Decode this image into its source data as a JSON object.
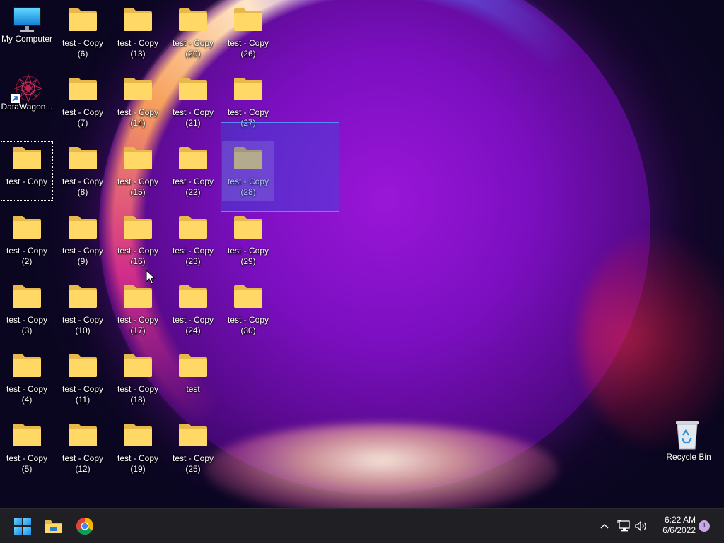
{
  "desktop": {
    "icons": [
      {
        "id": "my-computer",
        "label": "My Computer",
        "type": "monitor"
      },
      {
        "id": "datawagon",
        "label": "DataWagon...",
        "type": "shortcut"
      },
      {
        "id": "test-copy",
        "label": "test - Copy",
        "type": "folder"
      },
      {
        "id": "test-copy-2",
        "label": "test - Copy (2)",
        "type": "folder"
      },
      {
        "id": "test-copy-3",
        "label": "test - Copy (3)",
        "type": "folder"
      },
      {
        "id": "test-copy-4",
        "label": "test - Copy (4)",
        "type": "folder"
      },
      {
        "id": "test-copy-5",
        "label": "test - Copy (5)",
        "type": "folder"
      },
      {
        "id": "test-copy-6",
        "label": "test - Copy (6)",
        "type": "folder"
      },
      {
        "id": "test-copy-7",
        "label": "test - Copy (7)",
        "type": "folder"
      },
      {
        "id": "test-copy-8",
        "label": "test - Copy (8)",
        "type": "folder"
      },
      {
        "id": "test-copy-9",
        "label": "test - Copy (9)",
        "type": "folder"
      },
      {
        "id": "test-copy-10",
        "label": "test - Copy (10)",
        "type": "folder"
      },
      {
        "id": "test-copy-11",
        "label": "test - Copy (11)",
        "type": "folder"
      },
      {
        "id": "test-copy-12",
        "label": "test - Copy (12)",
        "type": "folder"
      },
      {
        "id": "test-copy-13",
        "label": "test - Copy (13)",
        "type": "folder"
      },
      {
        "id": "test-copy-14",
        "label": "test - Copy (14)",
        "type": "folder"
      },
      {
        "id": "test-copy-15",
        "label": "test - Copy (15)",
        "type": "folder"
      },
      {
        "id": "test-copy-16",
        "label": "test - Copy (16)",
        "type": "folder"
      },
      {
        "id": "test-copy-17",
        "label": "test - Copy (17)",
        "type": "folder"
      },
      {
        "id": "test-copy-18",
        "label": "test - Copy (18)",
        "type": "folder"
      },
      {
        "id": "test-copy-19",
        "label": "test - Copy (19)",
        "type": "folder"
      },
      {
        "id": "test-copy-20",
        "label": "test - Copy (20)",
        "type": "folder"
      },
      {
        "id": "test-copy-21",
        "label": "test - Copy (21)",
        "type": "folder"
      },
      {
        "id": "test-copy-22",
        "label": "test - Copy (22)",
        "type": "folder"
      },
      {
        "id": "test-copy-23",
        "label": "test - Copy (23)",
        "type": "folder"
      },
      {
        "id": "test-copy-24",
        "label": "test - Copy (24)",
        "type": "folder"
      },
      {
        "id": "test",
        "label": "test",
        "type": "folder"
      },
      {
        "id": "test-copy-25",
        "label": "test - Copy (25)",
        "type": "folder"
      },
      {
        "id": "test-copy-26",
        "label": "test - Copy (26)",
        "type": "folder"
      },
      {
        "id": "test-copy-27",
        "label": "test - Copy (27)",
        "type": "folder"
      },
      {
        "id": "test-copy-28",
        "label": "test - Copy (28)",
        "type": "folder"
      },
      {
        "id": "test-copy-29",
        "label": "test - Copy (29)",
        "type": "folder"
      },
      {
        "id": "test-copy-30",
        "label": "test - Copy (30)",
        "type": "folder"
      },
      {
        "id": "recycle-bin",
        "label": "Recycle Bin",
        "type": "recycle"
      }
    ]
  },
  "taskbar": {
    "pinned": [
      {
        "id": "start",
        "icon": "windows-start-icon"
      },
      {
        "id": "file-explorer",
        "icon": "file-explorer-icon"
      },
      {
        "id": "chrome",
        "icon": "chrome-icon"
      }
    ],
    "tray": {
      "icons": [
        "chevron-up-icon",
        "network-icon",
        "volume-icon"
      ],
      "time": "6:22 AM",
      "date": "6/6/2022",
      "notification_count": "1"
    }
  },
  "colors": {
    "folder_front": "#ffd866",
    "folder_back": "#e8b84a",
    "taskbar_bg": "#1f1f24",
    "selection_fill": "#285adc"
  }
}
